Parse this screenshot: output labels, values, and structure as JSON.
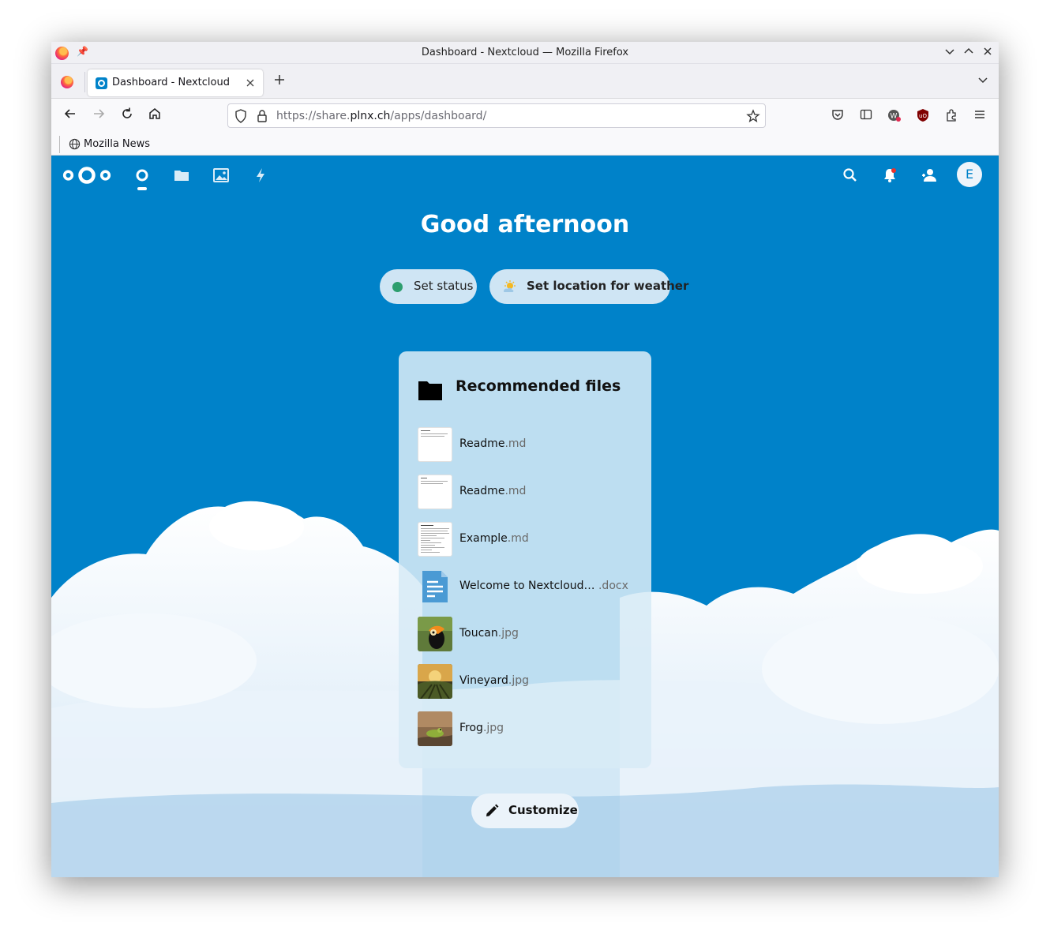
{
  "window": {
    "title": "Dashboard - Nextcloud — Mozilla Firefox"
  },
  "tabs": [
    {
      "label": "Dashboard - Nextcloud"
    }
  ],
  "urlbar": {
    "url_prefix": "https://share.",
    "url_domain": "plnx.ch",
    "url_suffix": "/apps/dashboard/"
  },
  "bookmarks": [
    {
      "label": "Mozilla News"
    }
  ],
  "nextcloud": {
    "avatar_initial": "E",
    "greeting": "Good afternoon",
    "set_status_label": "Set status",
    "weather_label": "Set location for weather",
    "recommended_title": "Recommended files",
    "files": [
      {
        "name": "Readme",
        "ext": ".md",
        "type": "doc"
      },
      {
        "name": "Readme",
        "ext": ".md",
        "type": "doc"
      },
      {
        "name": "Example",
        "ext": ".md",
        "type": "doc"
      },
      {
        "name": "Welcome to Nextcloud…",
        "ext": " .docx",
        "type": "docx"
      },
      {
        "name": "Toucan",
        "ext": ".jpg",
        "type": "image"
      },
      {
        "name": "Vineyard",
        "ext": ".jpg",
        "type": "image"
      },
      {
        "name": "Frog",
        "ext": ".jpg",
        "type": "image"
      }
    ],
    "customize_label": "Customize"
  },
  "colors": {
    "brand": "#0082c9",
    "status_online": "#2d9e6e"
  }
}
